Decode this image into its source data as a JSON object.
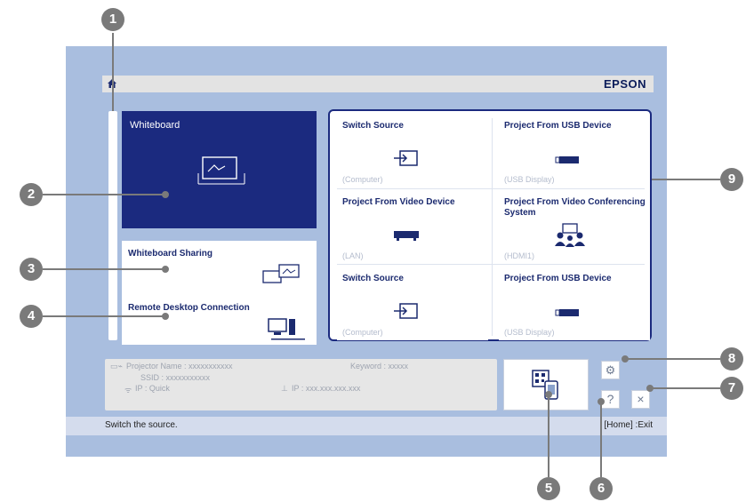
{
  "header": {
    "brand": "EPSON",
    "home_icon": "home-icon"
  },
  "whiteboard": {
    "label": "Whiteboard",
    "icon": "whiteboard-icon"
  },
  "lower_panel": {
    "whiteboard_sharing": "Whiteboard Sharing",
    "remote_desktop": "Remote Desktop Connection"
  },
  "tiles": [
    {
      "title": "Switch Source",
      "sub": "(Computer)",
      "icon": "switch-source-icon"
    },
    {
      "title": "Project From USB Device",
      "sub": "(USB Display)",
      "icon": "usb-icon"
    },
    {
      "title": "Project From Video Device",
      "sub": "(LAN)",
      "icon": "video-device-icon"
    },
    {
      "title": "Project From Video Conferencing System",
      "sub": "(HDMI1)",
      "icon": "video-conference-icon"
    },
    {
      "title": "Switch Source",
      "sub": "(Computer)",
      "icon": "switch-source-icon"
    },
    {
      "title": "Project From USB Device",
      "sub": "(USB Display)",
      "icon": "usb-icon"
    }
  ],
  "info": {
    "projector_name": "Projector Name : xxxxxxxxxxx",
    "keyword": "Keyword : xxxxx",
    "ssid": "SSID : xxxxxxxxxxx",
    "ip_mode": "IP : Quick",
    "ip": "IP : xxx.xxx.xxx.xxx"
  },
  "buttons": {
    "help": "?",
    "close": "×"
  },
  "status": {
    "text": "Switch the source.",
    "exit": "[Home] :Exit"
  },
  "callouts": [
    "1",
    "2",
    "3",
    "4",
    "5",
    "6",
    "7",
    "8",
    "9"
  ]
}
